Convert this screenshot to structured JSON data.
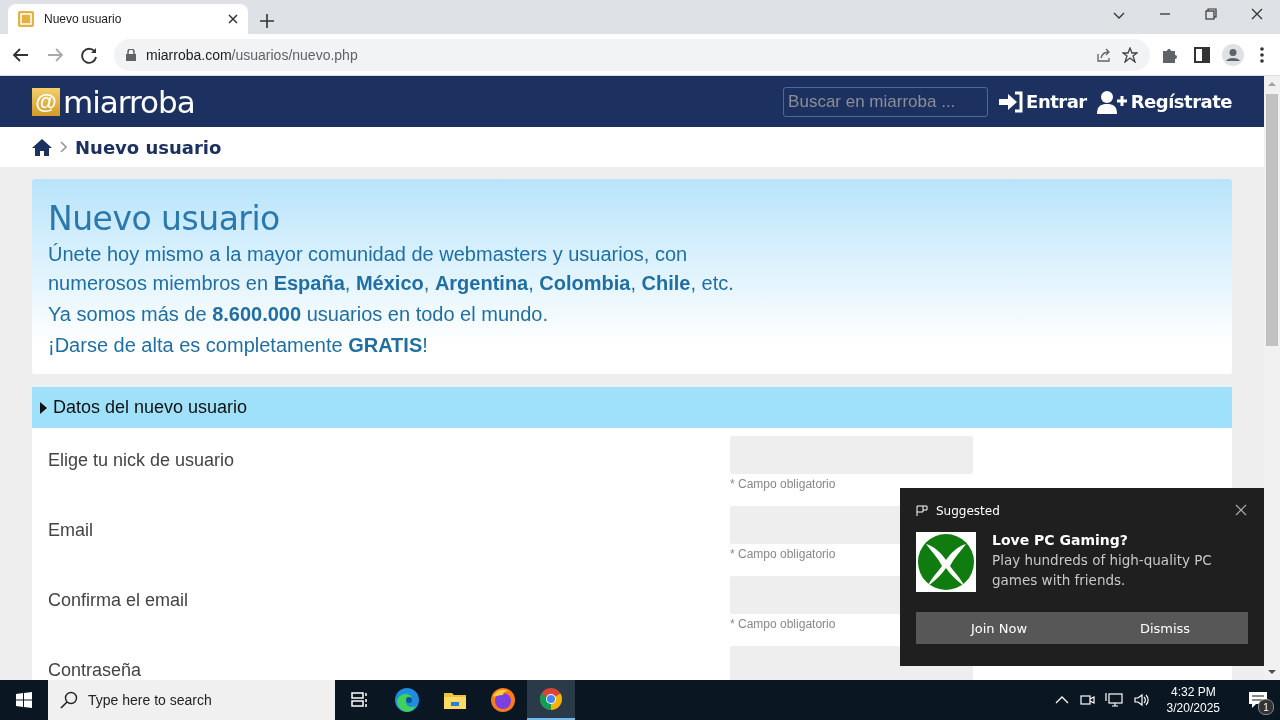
{
  "browser": {
    "tabs": [
      {
        "title": "Nuevo usuario",
        "selected": true
      }
    ],
    "url": {
      "host": "miarroba.com",
      "path": "/usuarios/nuevo.php"
    }
  },
  "site": {
    "logo": {
      "glyph": "@",
      "name": "miarroba"
    },
    "search_placeholder": "Buscar en miarroba ...",
    "nav": [
      {
        "label": "Entrar",
        "kind": "login"
      },
      {
        "label": "Regístrate",
        "kind": "register"
      }
    ]
  },
  "breadcrumb": {
    "current": "Nuevo usuario"
  },
  "banner": {
    "title": "Nuevo usuario",
    "paragraphs": [
      "Únete hoy mismo a la mayor comunidad de webmasters y usuarios, con numerosos miembros en **España**, **México**, **Argentina**, **Colombia**, **Chile**, etc.",
      "Ya somos más de **8.600.000** usuarios en todo el mundo.",
      "¡Darse de alta es completamente **GRATIS**!"
    ]
  },
  "form": {
    "section_title": "Datos del nuevo usuario",
    "fields": [
      {
        "label": "Elige tu nick de usuario",
        "hint": "* Campo obligatorio"
      },
      {
        "label": "Email",
        "hint": "* Campo obligatorio"
      },
      {
        "label": "Confirma el email",
        "hint": "* Campo obligatorio"
      },
      {
        "label": "Contraseña"
      }
    ]
  },
  "toast": {
    "source": "Suggested",
    "title": "Love PC Gaming?",
    "body": "Play hundreds of high-quality PC games with friends.",
    "buttons": [
      "Join Now",
      "Dismiss"
    ]
  },
  "taskbar": {
    "search_placeholder": "Type here to search",
    "apps": [
      {
        "kind": "task-view",
        "selected": false
      },
      {
        "kind": "edge",
        "selected": false
      },
      {
        "kind": "explorer",
        "selected": false
      },
      {
        "kind": "firefox",
        "selected": false
      },
      {
        "kind": "chrome",
        "selected": true
      }
    ],
    "time": "4:32 PM",
    "date": "3/20/2025",
    "notifications": "1"
  }
}
